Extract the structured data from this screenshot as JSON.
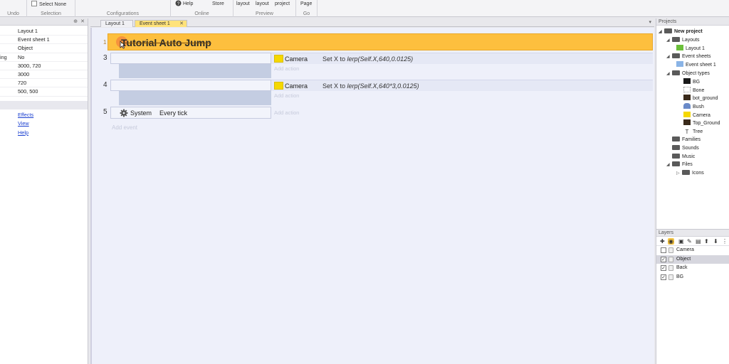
{
  "ribbon": {
    "undo_group": "Undo",
    "select_none": "Select None",
    "selection_group": "Selection",
    "configurations_group": "Configurations",
    "help": "Help",
    "store": "Store",
    "online_group": "Online",
    "preview_buttons": [
      "layout",
      "layout",
      "project"
    ],
    "preview_group": "Preview",
    "page": "Page",
    "go_group": "Go"
  },
  "properties": {
    "rows": [
      {
        "key": "",
        "value": "Layout 1"
      },
      {
        "key": "",
        "value": "Event sheet 1"
      },
      {
        "key": "",
        "value": "Object"
      },
      {
        "key": "ing",
        "value": "No"
      },
      {
        "key": "",
        "value": "3000, 720"
      },
      {
        "key": "",
        "value": "3000"
      },
      {
        "key": "",
        "value": "720"
      },
      {
        "key": "",
        "value": "500, 500"
      }
    ],
    "links": [
      "Effects",
      "View",
      "Help"
    ]
  },
  "tabs": [
    {
      "label": "Layout 1",
      "active": false
    },
    {
      "label": "Event sheet 1",
      "active": true
    }
  ],
  "event_sheet": {
    "comment": "Tutorial Auto Jump",
    "comment_line": "1",
    "events": [
      {
        "line": "3",
        "object": "Camera",
        "action_prefix": "Set X to ",
        "action_expr": "lerp(Self.X,640,0.0125)",
        "add_action": "Add action"
      },
      {
        "line": "4",
        "object": "Camera",
        "action_prefix": "Set X to ",
        "action_expr": "lerp(Self.X,640*3,0.0125)",
        "add_action": "Add action"
      },
      {
        "line": "5",
        "condition_object": "System",
        "condition": "Every tick",
        "add_action": "Add action"
      }
    ],
    "add_event": "Add event"
  },
  "projects": {
    "title": "Projects",
    "root": "New project",
    "nodes": [
      {
        "label": "Layouts",
        "kind": "folder"
      },
      {
        "label": "Layout 1",
        "kind": "layout"
      },
      {
        "label": "Event sheets",
        "kind": "folder"
      },
      {
        "label": "Event sheet 1",
        "kind": "sheet"
      },
      {
        "label": "Object types",
        "kind": "folder"
      },
      {
        "label": "BG",
        "kind": "object",
        "color": "#1a1a1a"
      },
      {
        "label": "Bone",
        "kind": "object",
        "color": "#d8d8d8"
      },
      {
        "label": "bot_ground",
        "kind": "object",
        "color": "#3a2a1a"
      },
      {
        "label": "Bush",
        "kind": "object",
        "color": "#6a8ac8"
      },
      {
        "label": "Camera",
        "kind": "object",
        "color": "#f5d800"
      },
      {
        "label": "Top_Ground",
        "kind": "object",
        "color": "#3a2a1a"
      },
      {
        "label": "Tree",
        "kind": "object",
        "color": "#333333"
      },
      {
        "label": "Families",
        "kind": "folder"
      },
      {
        "label": "Sounds",
        "kind": "folder"
      },
      {
        "label": "Music",
        "kind": "folder"
      },
      {
        "label": "Files",
        "kind": "folder"
      },
      {
        "label": "Icons",
        "kind": "folder"
      }
    ]
  },
  "layers": {
    "title": "Layers",
    "items": [
      {
        "name": "Camera",
        "checked": false,
        "selected": false
      },
      {
        "name": "Object",
        "checked": true,
        "selected": true
      },
      {
        "name": "Back",
        "checked": true,
        "selected": false
      },
      {
        "name": "BG",
        "checked": true,
        "selected": false
      }
    ]
  },
  "colors": {
    "comment_bg": "#fdbf3e",
    "active_tab": "#ffe27a",
    "camera_object": "#f5d800",
    "link": "#1a3fd0"
  }
}
